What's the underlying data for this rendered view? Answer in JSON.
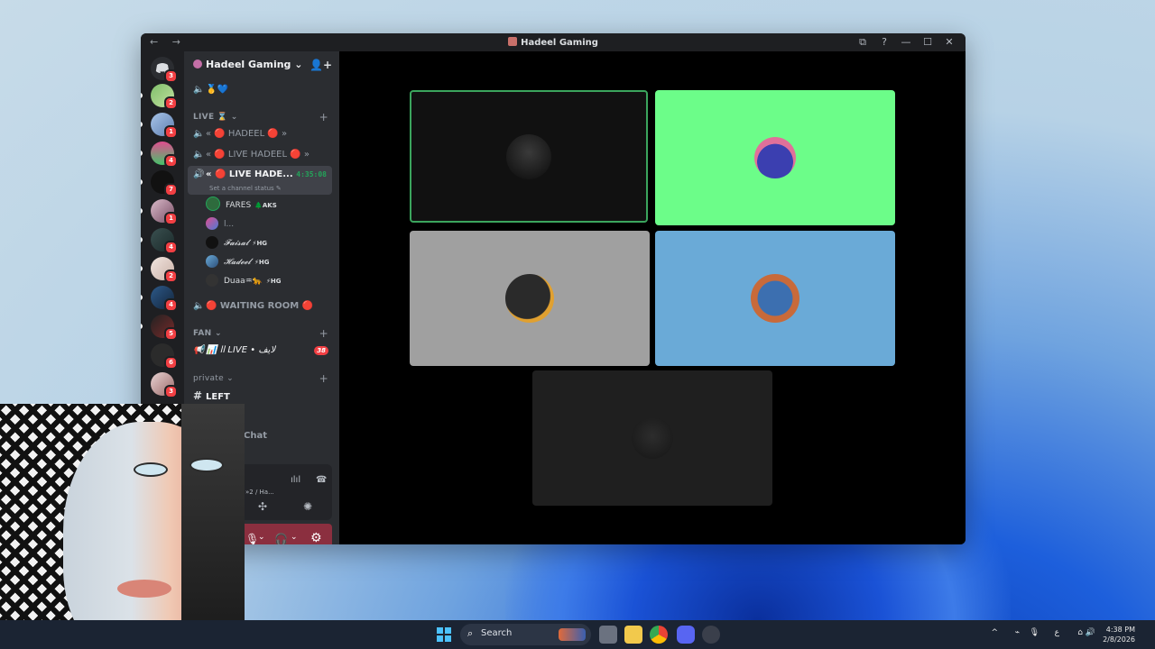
{
  "window": {
    "title": "Hadeel Gaming",
    "nav_icons": "← →",
    "buttons": [
      "⧉",
      "?",
      "—",
      "☐",
      "✕"
    ]
  },
  "rail": {
    "badges": [
      "3",
      "2",
      "1",
      "4",
      "7",
      "1",
      "4",
      "2",
      "4",
      "5",
      "6",
      "3"
    ]
  },
  "sidebar": {
    "server_name": "Hadeel Gaming",
    "server_chevron": "⌄",
    "top_channel_emojis": "🥇💙",
    "categories": {
      "live": "LIVE ⌛",
      "fan": "FAN",
      "private": "private"
    },
    "channels": {
      "hadeel": "« 🔴 HADEEL 🔴 »",
      "live_hadeel": "« 🔴 LIVE HADEEL 🔴 »",
      "active": "« 🔴 LIVE HADE...",
      "active_timer": "4:35:08",
      "active_status": "Set a channel status ✎",
      "waiting": "🔴 WAITING ROOM 🔴",
      "fan_live": "📊 اا LIVE • لايف",
      "fan_live_badge": "38",
      "left": "LEFT",
      "chat": "Chat"
    },
    "voice_users": [
      {
        "name": "FARES",
        "tag": "🌲AKS"
      },
      {
        "name": "l...",
        "tag": ""
      },
      {
        "name": "𝓕𝓪𝓲𝓼𝓪𝓵",
        "tag": "⚡HG"
      },
      {
        "name": "𝓗𝓪𝓭𝓮𝓮𝓵",
        "tag": "⚡HG"
      },
      {
        "name": "Duaa♒🐆",
        "tag": "⚡HG"
      }
    ],
    "voice_panel": {
      "location": "»2 / Ha..."
    }
  },
  "taskbar": {
    "search_placeholder": "Search",
    "tray_lang": "ع",
    "time": "4:38 PM",
    "date": "2/8/2026"
  },
  "colors": {
    "accent_green": "#23a55a",
    "tile_green": "#6cfd89",
    "tile_blue": "#6aaad7",
    "tile_gray": "#a0a0a0",
    "speaking_border": "#3ba55d"
  }
}
